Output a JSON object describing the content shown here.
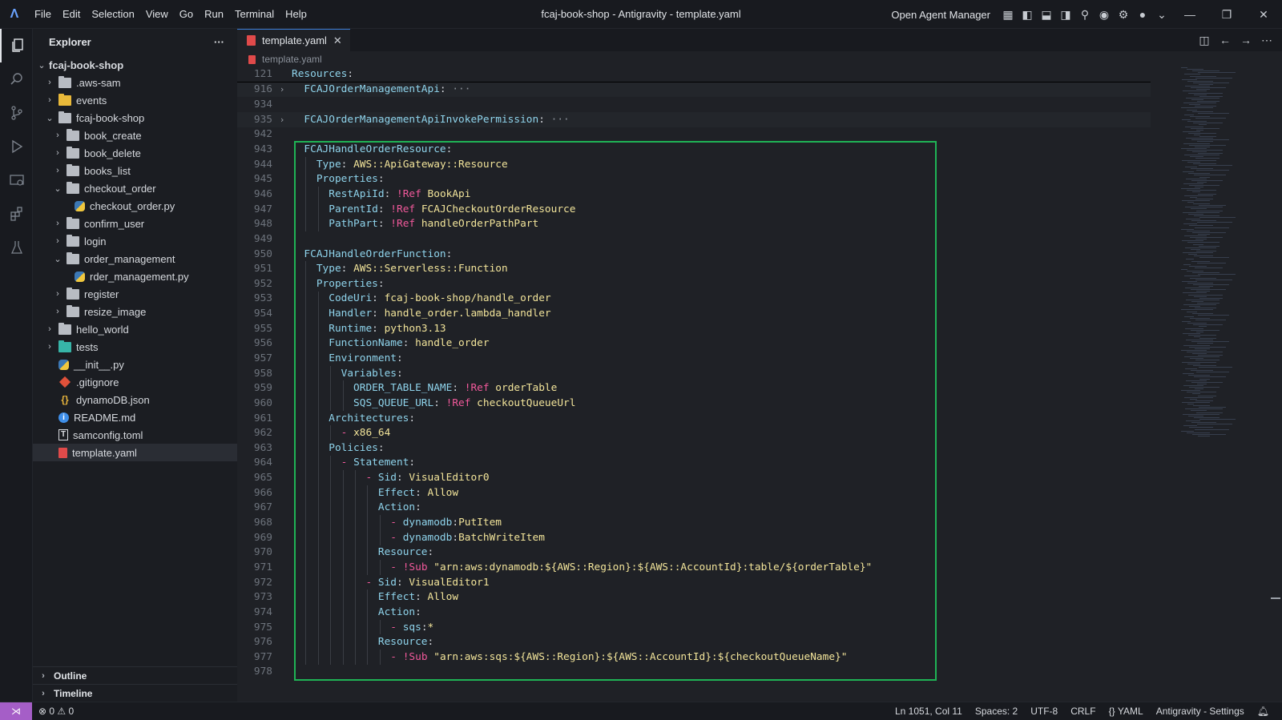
{
  "titlebar": {
    "menu": [
      "File",
      "Edit",
      "Selection",
      "View",
      "Go",
      "Run",
      "Terminal",
      "Help"
    ],
    "window_title": "fcaj-book-shop - Antigravity - template.yaml",
    "agent_manager": "Open Agent Manager"
  },
  "sidebar": {
    "title": "Explorer",
    "more": "···",
    "root": "fcaj-book-shop",
    "items": [
      {
        "label": ".aws-sam",
        "kind": "folder"
      },
      {
        "label": "events",
        "kind": "folder-yellow"
      },
      {
        "label": "fcaj-book-shop",
        "kind": "folder-open"
      },
      {
        "label": "book_create",
        "kind": "folder"
      },
      {
        "label": "book_delete",
        "kind": "folder"
      },
      {
        "label": "books_list",
        "kind": "folder"
      },
      {
        "label": "checkout_order",
        "kind": "folder-open"
      },
      {
        "label": "checkout_order.py",
        "kind": "py"
      },
      {
        "label": "confirm_user",
        "kind": "folder"
      },
      {
        "label": "login",
        "kind": "folder"
      },
      {
        "label": "order_management",
        "kind": "folder-open"
      },
      {
        "label": "rder_management.py",
        "kind": "py"
      },
      {
        "label": "register",
        "kind": "folder"
      },
      {
        "label": "resize_image",
        "kind": "folder"
      },
      {
        "label": "hello_world",
        "kind": "folder"
      },
      {
        "label": "tests",
        "kind": "folder-teal"
      },
      {
        "label": "__init__.py",
        "kind": "py"
      },
      {
        "label": ".gitignore",
        "kind": "git"
      },
      {
        "label": "dynamoDB.json",
        "kind": "json"
      },
      {
        "label": "README.md",
        "kind": "info"
      },
      {
        "label": "samconfig.toml",
        "kind": "toml"
      },
      {
        "label": "template.yaml",
        "kind": "yaml"
      }
    ],
    "outline": "Outline",
    "timeline": "Timeline"
  },
  "editor": {
    "tab_label": "template.yaml",
    "breadcrumb": "template.yaml",
    "lines": [
      {
        "n": "121",
        "t": "Resources:"
      },
      {
        "n": "916",
        "t": "  FCAJOrderManagementApi: ···"
      },
      {
        "n": "934",
        "t": ""
      },
      {
        "n": "935",
        "t": "  FCAJOrderManagementApiInvokePermission: ···"
      },
      {
        "n": "942",
        "t": ""
      },
      {
        "n": "943",
        "t": "  FCAJHandleOrderResource:"
      },
      {
        "n": "944",
        "t": "    Type: AWS::ApiGateway::Resource"
      },
      {
        "n": "945",
        "t": "    Properties:"
      },
      {
        "n": "946",
        "t": "      RestApiId: !Ref BookApi"
      },
      {
        "n": "947",
        "t": "      ParentId: !Ref FCAJCheckoutOrderResource"
      },
      {
        "n": "948",
        "t": "      PathPart: !Ref handleOrderPathPart"
      },
      {
        "n": "949",
        "t": ""
      },
      {
        "n": "950",
        "t": "  FCAJHandleOrderFunction:"
      },
      {
        "n": "951",
        "t": "    Type: AWS::Serverless::Function"
      },
      {
        "n": "952",
        "t": "    Properties:"
      },
      {
        "n": "953",
        "t": "      CodeUri: fcaj-book-shop/handle_order"
      },
      {
        "n": "954",
        "t": "      Handler: handle_order.lambda_handler"
      },
      {
        "n": "955",
        "t": "      Runtime: python3.13"
      },
      {
        "n": "956",
        "t": "      FunctionName: handle_order"
      },
      {
        "n": "957",
        "t": "      Environment:"
      },
      {
        "n": "958",
        "t": "        Variables:"
      },
      {
        "n": "959",
        "t": "          ORDER_TABLE_NAME: !Ref orderTable"
      },
      {
        "n": "960",
        "t": "          SQS_QUEUE_URL: !Ref checkoutQueueUrl"
      },
      {
        "n": "961",
        "t": "      Architectures:"
      },
      {
        "n": "962",
        "t": "        - x86_64"
      },
      {
        "n": "963",
        "t": "      Policies:"
      },
      {
        "n": "964",
        "t": "        - Statement:"
      },
      {
        "n": "965",
        "t": "            - Sid: VisualEditor0"
      },
      {
        "n": "966",
        "t": "              Effect: Allow"
      },
      {
        "n": "967",
        "t": "              Action:"
      },
      {
        "n": "968",
        "t": "                - dynamodb:PutItem"
      },
      {
        "n": "969",
        "t": "                - dynamodb:BatchWriteItem"
      },
      {
        "n": "970",
        "t": "              Resource:"
      },
      {
        "n": "971",
        "t": "                - !Sub \"arn:aws:dynamodb:${AWS::Region}:${AWS::AccountId}:table/${orderTable}\""
      },
      {
        "n": "972",
        "t": "            - Sid: VisualEditor1"
      },
      {
        "n": "973",
        "t": "              Effect: Allow"
      },
      {
        "n": "974",
        "t": "              Action:"
      },
      {
        "n": "975",
        "t": "                - sqs:*"
      },
      {
        "n": "976",
        "t": "              Resource:"
      },
      {
        "n": "977",
        "t": "                - !Sub \"arn:aws:sqs:${AWS::Region}:${AWS::AccountId}:${checkoutQueueName}\""
      },
      {
        "n": "978",
        "t": ""
      }
    ]
  },
  "statusbar": {
    "errors": "0",
    "warnings": "0",
    "position": "Ln 1051, Col 11",
    "spaces": "Spaces: 2",
    "encoding": "UTF-8",
    "eol": "CRLF",
    "language": "YAML",
    "settings": "Antigravity - Settings"
  },
  "colors": {
    "highlight_box": "#1fb355",
    "accent": "#3a7bd5",
    "remote": "#a55ec7"
  }
}
